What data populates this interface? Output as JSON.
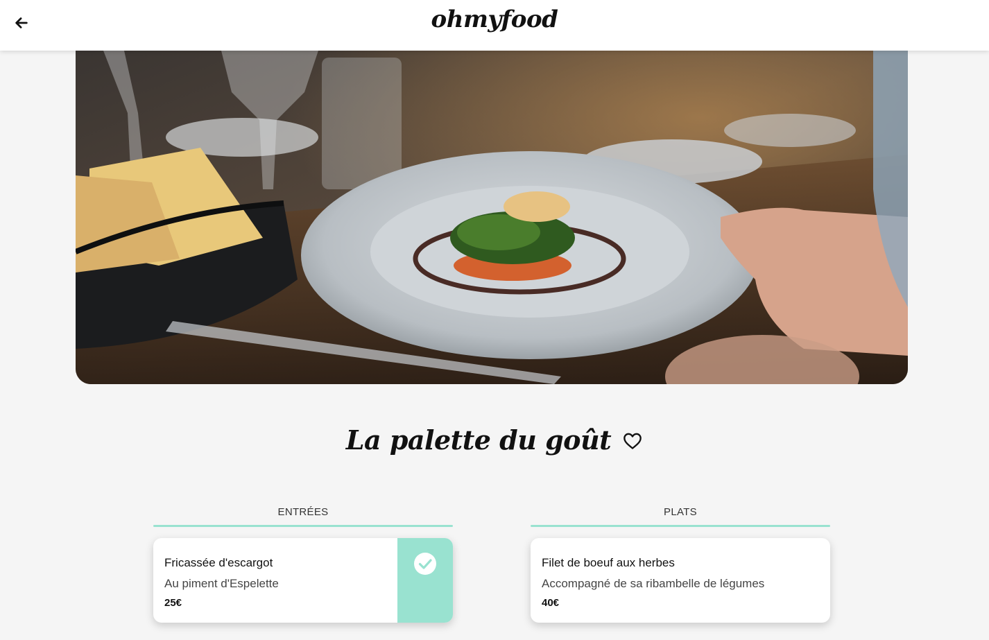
{
  "header": {
    "logo": "ohmyfood",
    "back_icon": "arrow-left-icon"
  },
  "hero": {
    "image_description_icon": "restaurant-plate-photo"
  },
  "restaurant": {
    "name": "La palette du goût",
    "favorite_icon": "heart-outline-icon"
  },
  "menu": {
    "sections": [
      {
        "title": "ENTRÉES",
        "dishes": [
          {
            "name": "Fricassée d'escargot",
            "description": "Au piment d'Espelette",
            "price": "25€",
            "selected": true
          }
        ]
      },
      {
        "title": "PLATS",
        "dishes": [
          {
            "name": "Filet de boeuf aux herbes",
            "description": "Accompagné de sa ribambelle de légumes",
            "price": "40€",
            "selected": false
          }
        ]
      }
    ]
  },
  "colors": {
    "accent": "#99e2d0",
    "background": "#f5f5f5",
    "card": "#ffffff"
  }
}
